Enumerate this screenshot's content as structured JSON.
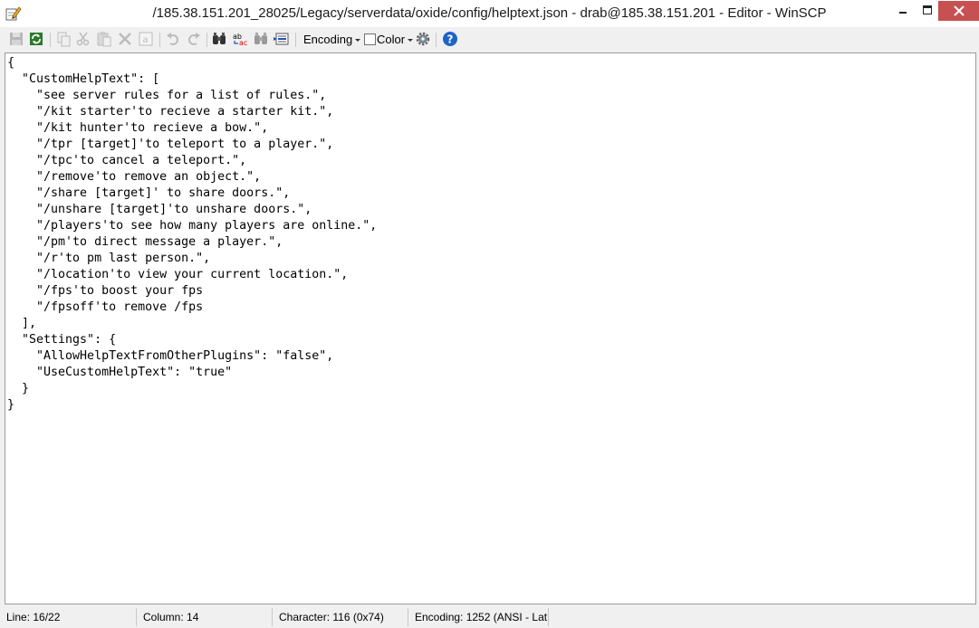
{
  "window": {
    "title": "/185.38.151.201_28025/Legacy/serverdata/oxide/config/helptext.json - drab@185.38.151.201 - Editor - WinSCP"
  },
  "toolbar": {
    "encoding_label": "Encoding",
    "color_label": "Color",
    "icons": [
      "save-icon",
      "reload-icon",
      "copy-icon",
      "cut-icon",
      "paste-icon",
      "delete-icon",
      "select-all-icon",
      "undo-icon",
      "redo-icon",
      "find-icon",
      "replace-icon",
      "find-next-icon",
      "goto-line-icon",
      "settings-icon",
      "help-icon"
    ]
  },
  "editor": {
    "lines": [
      "{",
      "  \"CustomHelpText\": [",
      "    \"see server rules for a list of rules.\",",
      "    \"/kit starter'to recieve a starter kit.\",",
      "    \"/kit hunter'to recieve a bow.\",",
      "    \"/tpr [target]'to teleport to a player.\",",
      "    \"/tpc'to cancel a teleport.\",",
      "    \"/remove'to remove an object.\",",
      "    \"/share [target]' to share doors.\",",
      "    \"/unshare [target]'to unshare doors.\",",
      "    \"/players'to see how many players are online.\",",
      "    \"/pm'to direct message a player.\",",
      "    \"/r'to pm last person.\",",
      "    \"/location'to view your current location.\",",
      "    \"/fps'to boost your fps",
      "    \"/fpsoff'to remove /fps",
      "  ],",
      "  \"Settings\": {",
      "    \"AllowHelpTextFromOtherPlugins\": \"false\",",
      "    \"UseCustomHelpText\": \"true\"",
      "  }",
      "}"
    ]
  },
  "status": {
    "line": "Line: 16/22",
    "column": "Column: 14",
    "character": "Character: 116 (0x74)",
    "encoding": "Encoding: 1252  (ANSI - Lat"
  }
}
